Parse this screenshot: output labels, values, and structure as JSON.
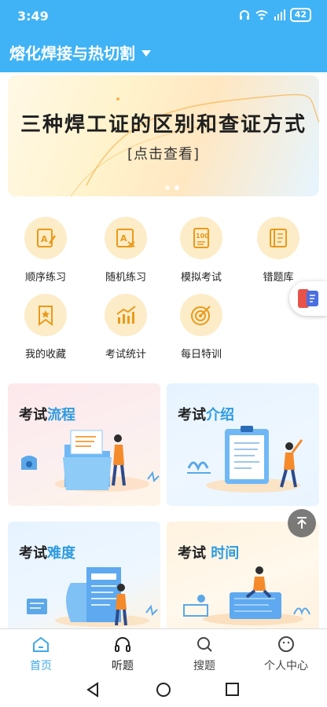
{
  "status_bar": {
    "time": "3:49",
    "battery": "42"
  },
  "header": {
    "title": "熔化焊接与热切割"
  },
  "banner": {
    "title": "三种焊工证的区别和查证方式",
    "subtitle": "[点击查看]"
  },
  "menu": {
    "items": [
      {
        "label": "顺序练习",
        "icon": "sequential-practice-icon"
      },
      {
        "label": "随机练习",
        "icon": "random-practice-icon"
      },
      {
        "label": "模拟考试",
        "icon": "mock-exam-icon"
      },
      {
        "label": "错题库",
        "icon": "wrong-questions-icon"
      },
      {
        "label": "我的收藏",
        "icon": "favorites-icon"
      },
      {
        "label": "考试统计",
        "icon": "exam-statistics-icon"
      },
      {
        "label": "每日特训",
        "icon": "daily-training-icon"
      }
    ]
  },
  "cards": [
    {
      "prefix": "考试",
      "highlight": "流程"
    },
    {
      "prefix": "考试",
      "highlight": "介绍"
    },
    {
      "prefix": "考试",
      "highlight": "难度"
    },
    {
      "prefix": "考试 ",
      "highlight": "时间"
    }
  ],
  "tabbar": {
    "tabs": [
      {
        "label": "首页",
        "icon": "home-icon",
        "active": true
      },
      {
        "label": "听题",
        "icon": "headphones-icon",
        "active": false
      },
      {
        "label": "搜题",
        "icon": "search-icon",
        "active": false
      },
      {
        "label": "个人中心",
        "icon": "profile-icon",
        "active": false
      }
    ]
  },
  "colors": {
    "primary": "#3fb3f5",
    "accent_text": "#2f9be0",
    "icon_bg": "#fdecc8",
    "icon_fg": "#f0a020"
  }
}
